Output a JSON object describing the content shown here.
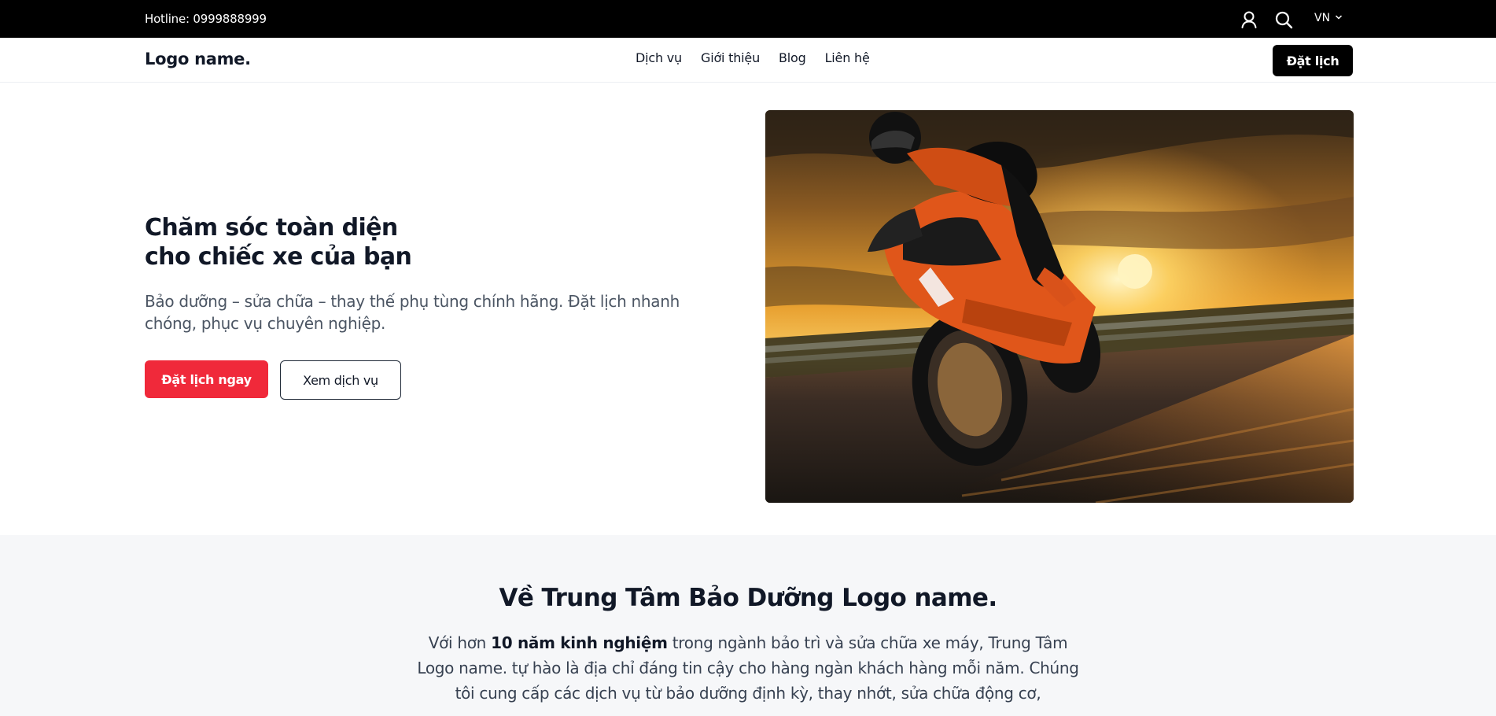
{
  "topbar": {
    "hotline": "Hotline: 0999888999",
    "language": "VN",
    "icons": [
      "user-icon",
      "search-icon",
      "chevron-down-icon"
    ]
  },
  "navbar": {
    "logo": "Logo name.",
    "menu": [
      {
        "label": "Dịch vụ"
      },
      {
        "label": "Giới thiệu"
      },
      {
        "label": "Blog"
      },
      {
        "label": "Liên hệ"
      }
    ],
    "cta": "Đặt lịch"
  },
  "hero": {
    "title_line1": "Chăm sóc toàn diện",
    "title_line2": "cho chiếc xe của bạn",
    "subtitle": "Bảo dưỡng – sửa chữa – thay thế phụ tùng chính hãng. Đặt lịch nhanh chóng, phục vụ chuyên nghiệp.",
    "primary_button": "Đặt lịch ngay",
    "secondary_button": "Xem dịch vụ"
  },
  "about": {
    "title": "Về Trung Tâm Bảo Dưỡng Logo name.",
    "intro_prefix": "Với hơn ",
    "intro_highlight": "10 năm kinh nghiệm",
    "intro_rest": " trong ngành bảo trì và sửa chữa xe máy, Trung Tâm Logo name. tự hào là địa chỉ đáng tin cậy cho hàng ngàn khách hàng mỗi năm. Chúng tôi cung cấp các dịch vụ từ bảo dưỡng định kỳ, thay nhớt, sửa chữa động cơ,"
  },
  "colors": {
    "topbar_bg": "#000000",
    "primary_red": "#f0293a",
    "text_dark": "#111827",
    "text_muted": "#4b5563",
    "section_bg": "#f6f7f9"
  }
}
